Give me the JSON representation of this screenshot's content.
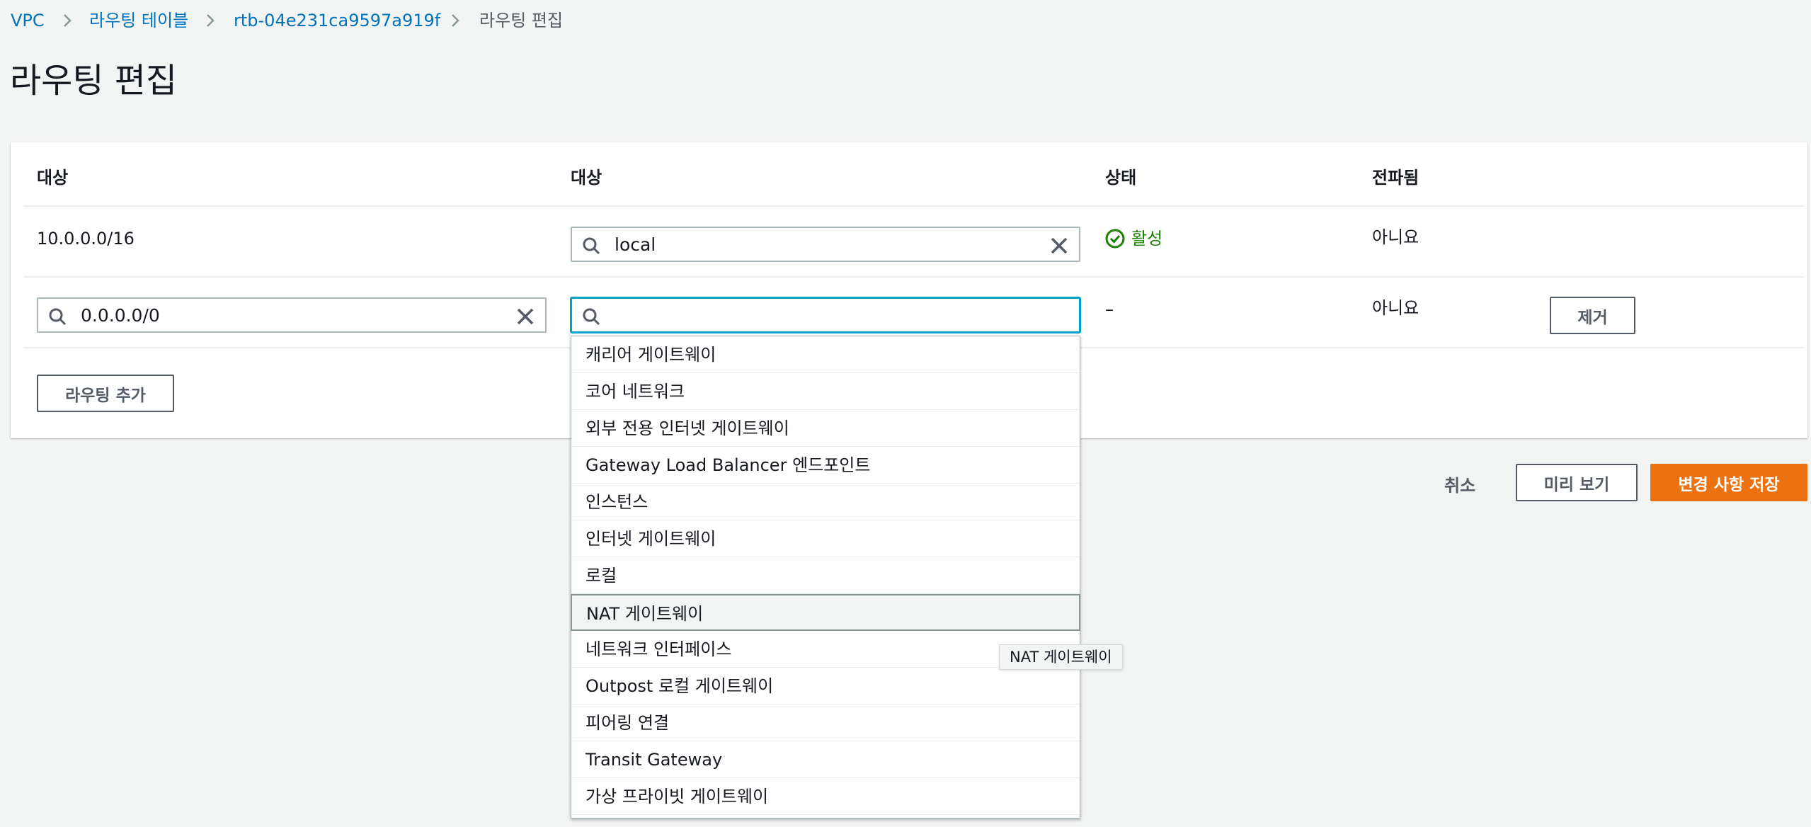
{
  "breadcrumb": {
    "vpc": "VPC",
    "route_tables": "라우팅 테이블",
    "route_table_id": "rtb-04e231ca9597a919f",
    "current": "라우팅 편집"
  },
  "page_title": "라우팅 편집",
  "table": {
    "headers": {
      "destination": "대상",
      "target": "대상",
      "status": "상태",
      "propagated": "전파됨"
    },
    "rows": [
      {
        "destination": "10.0.0.0/16",
        "target": "local",
        "status": "활성",
        "propagated": "아니요"
      },
      {
        "destination": "0.0.0.0/0",
        "target": "",
        "status": "–",
        "propagated": "아니요",
        "remove_label": "제거"
      }
    ]
  },
  "add_route_label": "라우팅 추가",
  "footer": {
    "cancel": "취소",
    "preview": "미리 보기",
    "save": "변경 사항 저장"
  },
  "dropdown": {
    "options": [
      "캐리어 게이트웨이",
      "코어 네트워크",
      "외부 전용 인터넷 게이트웨이",
      "Gateway Load Balancer 엔드포인트",
      "인스턴스",
      "인터넷 게이트웨이",
      "로컬",
      "NAT 게이트웨이",
      "네트워크 인터페이스",
      "Outpost 로컬 게이트웨이",
      "피어링 연결",
      "Transit Gateway",
      "가상 프라이빗 게이트웨이"
    ],
    "hovered_index": 7
  },
  "tooltip": "NAT 게이트웨이",
  "colors": {
    "link": "#0073bb",
    "primary": "#ec7211",
    "success": "#1d8102",
    "focus": "#00a1c9"
  }
}
